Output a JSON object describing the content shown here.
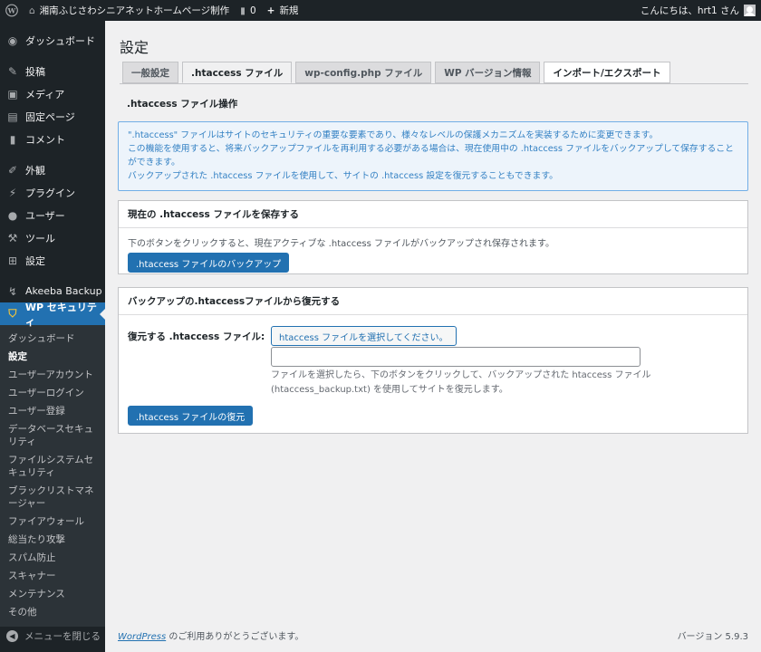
{
  "adminbar": {
    "site_name": "湘南ふじさわシニアネットホームページ制作",
    "comments_count": "0",
    "new_label": "新規",
    "greeting": "こんにちは、hrt1 さん"
  },
  "sidebar": {
    "dashboard": "ダッシュボード",
    "items": [
      {
        "label": "投稿",
        "icon": "pin-icon"
      },
      {
        "label": "メディア",
        "icon": "media-icon"
      },
      {
        "label": "固定ページ",
        "icon": "page-icon"
      },
      {
        "label": "コメント",
        "icon": "comment-icon"
      }
    ],
    "items2": [
      {
        "label": "外観",
        "icon": "brush-icon"
      },
      {
        "label": "プラグイン",
        "icon": "plugin-icon"
      },
      {
        "label": "ユーザー",
        "icon": "user-icon"
      },
      {
        "label": "ツール",
        "icon": "wrench-icon"
      },
      {
        "label": "設定",
        "icon": "settings-icon"
      }
    ],
    "akeeba": "Akeeba Backup",
    "wp_security": "WP セキュリティ",
    "submenu": [
      "ダッシュボード",
      "設定",
      "ユーザーアカウント",
      "ユーザーログイン",
      "ユーザー登録",
      "データベースセキュリティ",
      "ファイルシステムセキュリティ",
      "ブラックリストマネージャー",
      "ファイアウォール",
      "総当たり攻撃",
      "スパム防止",
      "スキャナー",
      "メンテナンス",
      "その他"
    ],
    "collapse": "メニューを閉じる"
  },
  "main": {
    "title": "設定",
    "tabs": [
      {
        "label": "一般設定"
      },
      {
        "label": ".htaccess ファイル"
      },
      {
        "label": "wp-config.php ファイル"
      },
      {
        "label": "WP バージョン情報"
      },
      {
        "label": "インポート/エクスポート"
      }
    ],
    "section_title": ".htaccess ファイル操作",
    "info_lines": [
      "\".htaccess\" ファイルはサイトのセキュリティの重要な要素であり、様々なレベルの保護メカニズムを実装するために変更できます。",
      "この機能を使用すると、将来バックアップファイルを再利用する必要がある場合は、現在使用中の .htaccess ファイルをバックアップして保存することができます。",
      "バックアップされた .htaccess ファイルを使用して、サイトの .htaccess 設定を復元することもできます。"
    ],
    "backup_box": {
      "title": "現在の .htaccess ファイルを保存する",
      "text": "下のボタンをクリックすると、現在アクティブな .htaccess ファイルがバックアップされ保存されます。",
      "button": ".htaccess ファイルのバックアップ"
    },
    "restore_box": {
      "title": "バックアップの.htaccessファイルから復元する",
      "label": "復元する .htaccess ファイル:",
      "file_button": "htaccess ファイルを選択してください。",
      "desc_1": "ファイルを選択したら、下のボタンをクリックして、バックアップされた htaccess ファイル",
      "desc_2": "(htaccess_backup.txt) を使用してサイトを復元します。",
      "button": ".htaccess ファイルの復元"
    }
  },
  "footer": {
    "link": "WordPress",
    "thanks": " のご利用ありがとうございます。",
    "version": "バージョン 5.9.3"
  }
}
